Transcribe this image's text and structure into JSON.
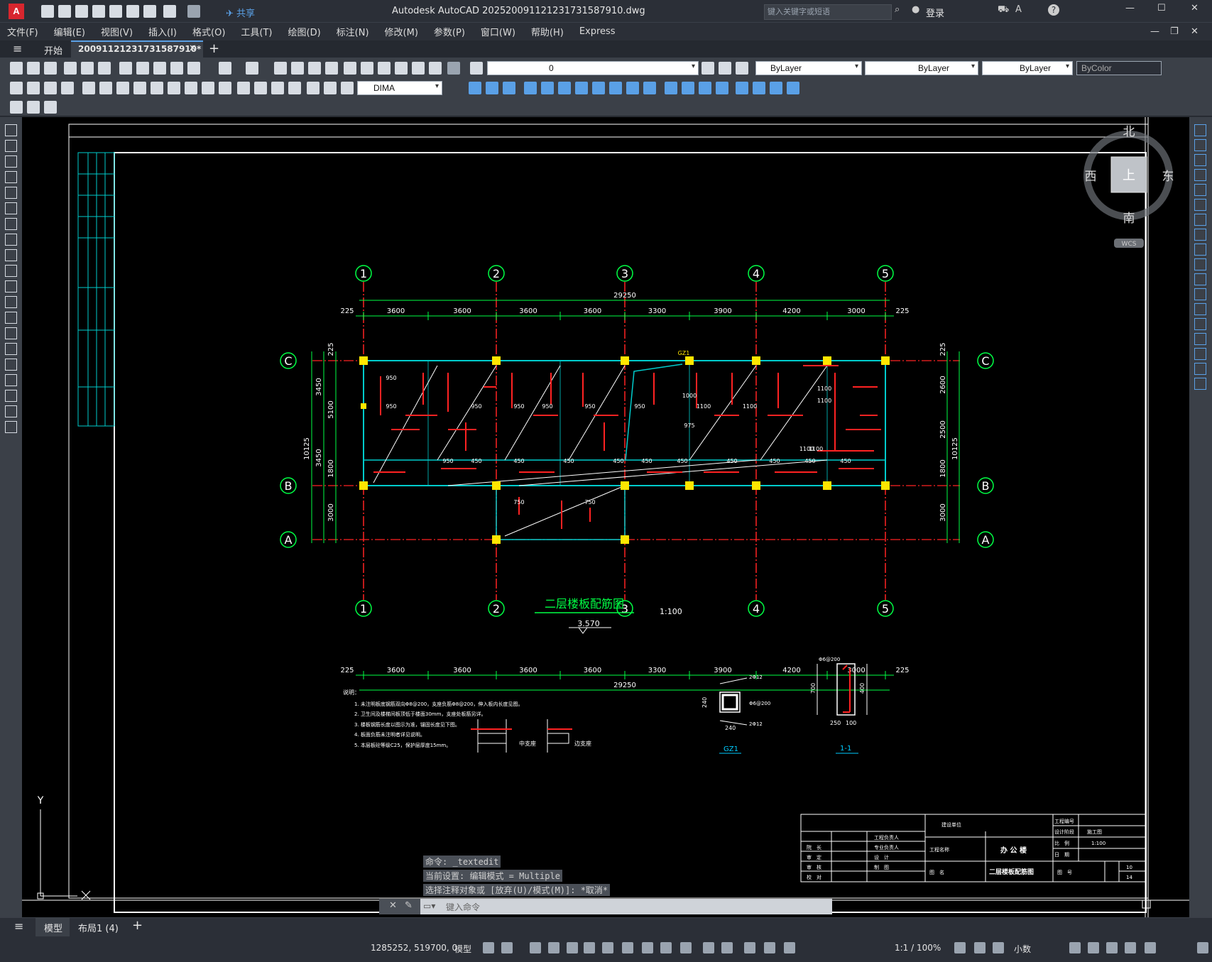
{
  "titlebar": {
    "app_title": "Autodesk AutoCAD 2025",
    "file_name": "200911212317315879​10.dwg",
    "search_placeholder": "键入关键字或短语",
    "login_label": "登录",
    "share_label": "共享"
  },
  "menu": [
    "文件(F)",
    "编辑(E)",
    "视图(V)",
    "插入(I)",
    "格式(O)",
    "工具(T)",
    "绘图(D)",
    "标注(N)",
    "修改(M)",
    "参数(P)",
    "窗口(W)",
    "帮助(H)",
    "Express"
  ],
  "tabs": {
    "start": "开始",
    "document": "20091121231731587910*"
  },
  "props": {
    "layer": "0",
    "color": "ByLayer",
    "linetype": "ByLayer",
    "lineweight": "ByLayer",
    "plotstyle": "ByColor",
    "dimstyle": "DIMA"
  },
  "viewcube": {
    "north": "北",
    "south": "南",
    "east": "东",
    "west": "西",
    "top": "上",
    "wcs": "WCS"
  },
  "drawing": {
    "grid_numbers": [
      "1",
      "2",
      "3",
      "4",
      "5"
    ],
    "grid_letters": [
      "C",
      "B",
      "A"
    ],
    "total_dim": "29250",
    "spans": [
      "3600",
      "3600",
      "3600",
      "3600",
      "3300",
      "3900",
      "4200",
      "3000"
    ],
    "edge_dim": "225",
    "left_dims": [
      "225",
      "5100",
      "3450",
      "10125",
      "1800",
      "3450",
      "3000"
    ],
    "right_dims": [
      "225",
      "2600",
      "2500",
      "10125",
      "1800",
      "3000"
    ],
    "title": "二层楼板配筋图",
    "scale": "1:100",
    "elevation": "3.570",
    "notes_title": "说明：",
    "notes": [
      "1. 未注明板底钢筋双向Φ8@200，支座负筋Φ8@200，伸入板内长度见图。",
      "2. 卫生间及楼梯间板顶低于楼面30mm，支座处板筋另详。",
      "3. 楼板钢筋长度以图示为准，锚固长度见下图。",
      "4. 板面负筋未注明者详见说明。",
      "5. 本层板砼等级C25，保护层厚度15mm。"
    ],
    "seat_mid": "中支座",
    "seat_edge": "边支座",
    "gz1_label": "GZ1",
    "gz1_dims": [
      "240",
      "240",
      "2Φ12",
      "Φ6@200",
      "2Φ12"
    ],
    "section_label": "1-1",
    "section_dims": [
      "Φ6@200",
      "700",
      "250",
      "100",
      "400"
    ]
  },
  "title_block": {
    "project_no": "工程编号",
    "stage": "设计阶段",
    "stage_val": "施工图",
    "scale_label": "比　例",
    "scale_val": "1:100",
    "date_label": "日　期",
    "client": "建设单位",
    "project_label": "工程名称",
    "project_val": "办 公 楼",
    "drawing_label": "图　名",
    "drawing_val": "二层楼板配筋图",
    "drawing_no": "图　号",
    "sheet": "10",
    "total": "14",
    "roles": [
      "院　长",
      "审　定",
      "审　核",
      "校　对"
    ],
    "roles2": [
      "工程负责人",
      "专业负责人",
      "设　计",
      "制　图"
    ]
  },
  "command": {
    "history": [
      "命令: _textedit",
      "当前设置: 编辑模式 = Multiple",
      "选择注释对象或 [放弃(U)/模式(M)]: *取消*"
    ],
    "placeholder": "键入命令"
  },
  "layout_tabs": [
    "模型",
    "布局1 (4)"
  ],
  "status": {
    "coords": "1285252, 519700, 0",
    "model": "模型",
    "scale": "1:1 / 100%",
    "units": "小数"
  }
}
